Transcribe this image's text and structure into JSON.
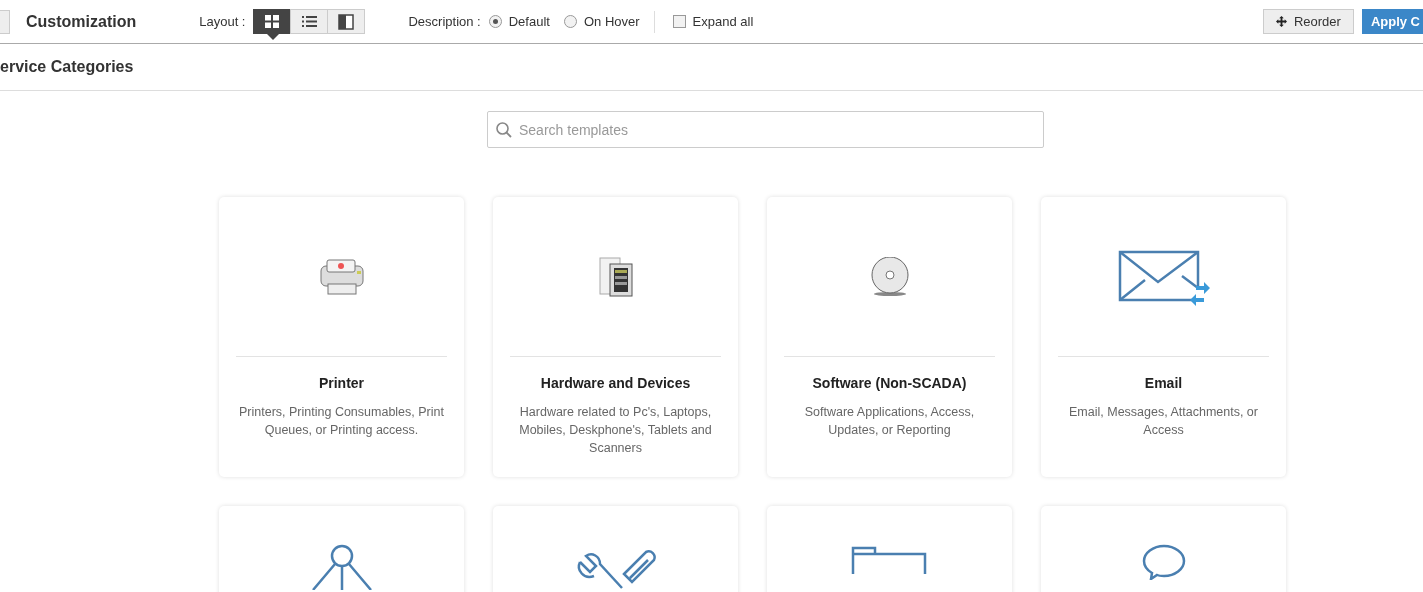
{
  "header": {
    "title": "Customization",
    "layout_label": "Layout :",
    "layouts": [
      {
        "selected": true
      },
      {
        "selected": false
      },
      {
        "selected": false
      }
    ],
    "description_label": "Description :",
    "description_options": [
      {
        "label": "Default",
        "selected": true
      },
      {
        "label": "On Hover",
        "selected": false
      }
    ],
    "expand_all": {
      "label": "Expand all",
      "checked": false
    },
    "reorder_button": "Reorder",
    "apply_button": "Apply C"
  },
  "section_title": "ervice Categories",
  "search": {
    "placeholder": "Search templates"
  },
  "cards": [
    {
      "kind": "full",
      "title": "Printer",
      "description": "Printers, Printing Consumables, Print Queues, or Printing access."
    },
    {
      "kind": "full",
      "title": "Hardware and Devices",
      "description": "Hardware related to Pc's, Laptops, Mobiles, Deskphone's, Tablets and Scanners"
    },
    {
      "kind": "full",
      "title": "Software (Non-SCADA)",
      "description": "Software Applications, Access, Updates, or Reporting"
    },
    {
      "kind": "full",
      "title": "Email",
      "description": "Email, Messages, Attachments, or Access"
    },
    {
      "kind": "cut"
    },
    {
      "kind": "cut"
    },
    {
      "kind": "cut"
    },
    {
      "kind": "cut"
    }
  ]
}
